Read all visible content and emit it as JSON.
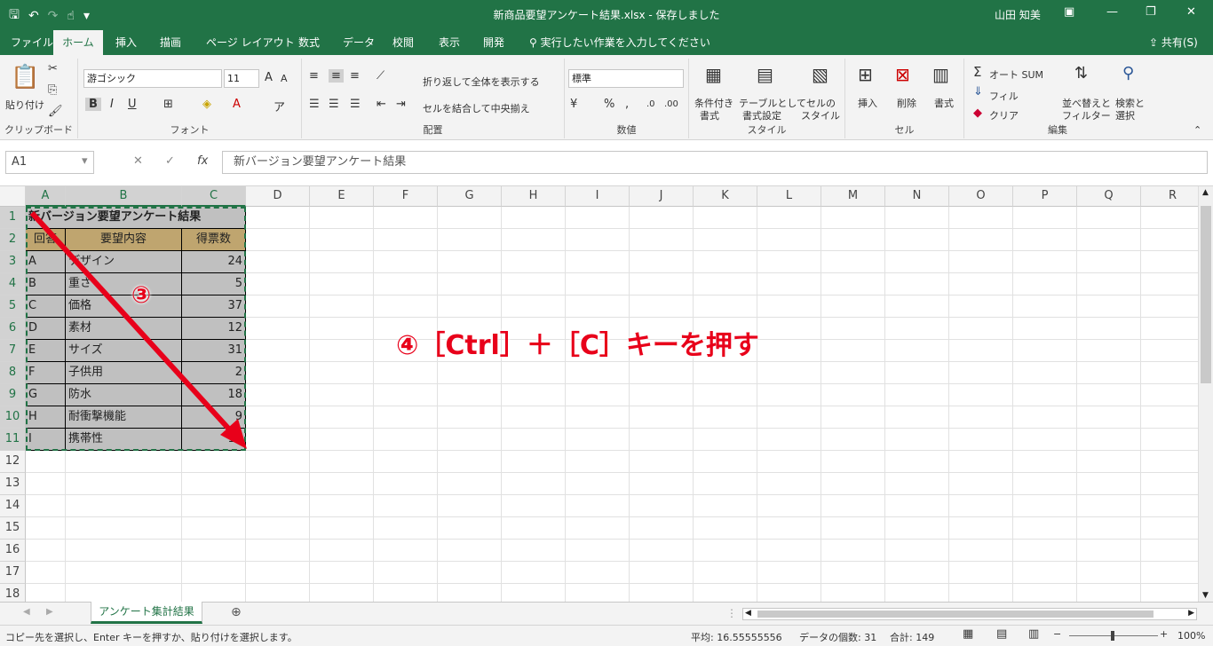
{
  "window": {
    "title": "新商品要望アンケート結果.xlsx - 保存しました",
    "user": "山田 知美"
  },
  "ribbon_tabs": [
    "ファイル",
    "ホーム",
    "挿入",
    "描画",
    "ページ レイアウト",
    "数式",
    "データ",
    "校閲",
    "表示",
    "開発"
  ],
  "tell_me": "実行したい作業を入力してください",
  "share": "共有(S)",
  "ribbon": {
    "clipboard": {
      "paste": "貼り付け",
      "label": "クリップボード"
    },
    "font": {
      "name": "游ゴシック",
      "size": "11",
      "label": "フォント"
    },
    "alignment": {
      "wrap": "折り返して全体を表示する",
      "merge": "セルを結合して中央揃え",
      "label": "配置"
    },
    "number": {
      "format": "標準",
      "label": "数値"
    },
    "styles": {
      "conditional": [
        "条件付き",
        "書式"
      ],
      "table": [
        "テーブルとして",
        "書式設定"
      ],
      "cell": [
        "セルの",
        "スタイル"
      ],
      "label": "スタイル"
    },
    "cells": {
      "insert": "挿入",
      "delete": "削除",
      "format": "書式",
      "label": "セル"
    },
    "editing": {
      "autosum": "オート SUM",
      "fill": "フィル",
      "clear": "クリア",
      "sort": [
        "並べ替えと",
        "フィルター"
      ],
      "find": [
        "検索と",
        "選択"
      ],
      "label": "編集"
    }
  },
  "formula_bar": {
    "name_box": "A1",
    "fx": "fx",
    "content": "新バージョン要望アンケート結果"
  },
  "columns": [
    "A",
    "B",
    "C",
    "D",
    "E",
    "F",
    "G",
    "H",
    "I",
    "J",
    "K",
    "L",
    "M",
    "N",
    "O",
    "P",
    "Q",
    "R"
  ],
  "rows": [
    "1",
    "2",
    "3",
    "4",
    "5",
    "6",
    "7",
    "8",
    "9",
    "10",
    "11",
    "12",
    "13",
    "14",
    "15",
    "16",
    "17",
    "18"
  ],
  "sheet": {
    "title": "新バージョン要望アンケート結果",
    "headers": [
      "回答",
      "要望内容",
      "得票数"
    ],
    "data": [
      [
        "A",
        "デザイン",
        "24"
      ],
      [
        "B",
        "重さ",
        "5"
      ],
      [
        "C",
        "価格",
        "37"
      ],
      [
        "D",
        "素材",
        "12"
      ],
      [
        "E",
        "サイズ",
        "31"
      ],
      [
        "F",
        "子供用",
        "2"
      ],
      [
        "G",
        "防水",
        "18"
      ],
      [
        "H",
        "耐衝撃機能",
        "9"
      ],
      [
        "I",
        "携帯性",
        "11"
      ]
    ]
  },
  "annotations": {
    "step3": "③",
    "step4": "④［Ctrl］＋［C］キーを押す",
    "accent_color": "#e8001a"
  },
  "sheet_tabs": [
    "アンケート集計結果"
  ],
  "status_bar": {
    "message": "コピー先を選択し、Enter キーを押すか、貼り付けを選択します。",
    "average": "平均: 16.55555556",
    "count": "データの個数: 31",
    "sum": "合計: 149",
    "zoom": "100%"
  },
  "colors": {
    "excel_green": "#217346",
    "header_fill": "#bfa56f",
    "table_fill": "#c0c0c0"
  }
}
